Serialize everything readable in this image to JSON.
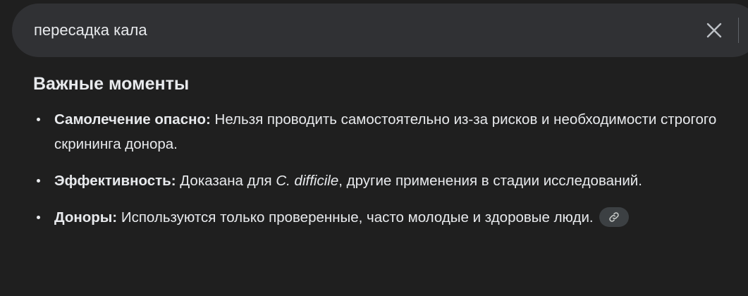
{
  "search": {
    "value": "пересадка кала",
    "clear_icon": "close-icon"
  },
  "section": {
    "heading": "Важные моменты",
    "items": [
      {
        "label": "Самолечение опасно:",
        "text": " Нельзя проводить самостоятельно из-за рисков и необходимости строгого скрининга донора."
      },
      {
        "label": "Эффективность:",
        "text_before": " Доказана для ",
        "text_italic": "C. difficile",
        "text_after": ", другие применения в стадии исследований."
      },
      {
        "label": "Доноры:",
        "text": " Используются только проверенные, часто молодые и здоровые люди.",
        "link_icon": "link-icon"
      }
    ]
  },
  "colors": {
    "background": "#1f1f1f",
    "search_bar": "#303134",
    "text": "#e8eaed",
    "chip": "#3c4043"
  }
}
